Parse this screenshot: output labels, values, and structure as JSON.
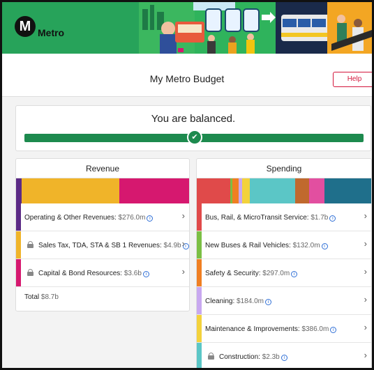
{
  "header": {
    "logo_letter": "M",
    "brand": "Metro"
  },
  "page": {
    "title": "My Metro Budget",
    "help_label": "Help"
  },
  "balance": {
    "message": "You are balanced.",
    "check_icon": "checkmark-icon"
  },
  "revenue": {
    "heading": "Revenue",
    "segments": [
      {
        "color": "#5b2a86",
        "share": 0.032
      },
      {
        "color": "#f0b429",
        "share": 0.563
      },
      {
        "color": "#d6186f",
        "share": 0.405
      }
    ],
    "rows": [
      {
        "label": "Operating & Other Revenues:",
        "amount": "$276.0m",
        "color": "#5b2a86",
        "locked": false
      },
      {
        "label": "Sales Tax, TDA, STA & SB 1 Revenues:",
        "amount": "$4.9b",
        "color": "#f0b429",
        "locked": true
      },
      {
        "label": "Capital & Bond Resources:",
        "amount": "$3.6b",
        "color": "#d6186f",
        "locked": true
      }
    ],
    "total_label": "Total",
    "total_amount": "$8.7b"
  },
  "spending": {
    "heading": "Spending",
    "segments": [
      {
        "color": "#e04a4a",
        "share": 0.19
      },
      {
        "color": "#7bbf44",
        "share": 0.014
      },
      {
        "color": "#f07f22",
        "share": 0.034
      },
      {
        "color": "#c8a8f0",
        "share": 0.021
      },
      {
        "color": "#f3d23c",
        "share": 0.044
      },
      {
        "color": "#5bc6c6",
        "share": 0.26
      },
      {
        "color": "#c0692e",
        "share": 0.08
      },
      {
        "color": "#e24fa0",
        "share": 0.09
      },
      {
        "color": "#1f6f8b",
        "share": 0.267
      }
    ],
    "rows": [
      {
        "label": "Bus, Rail, & MicroTransit Service:",
        "amount": "$1.7b",
        "color": "#e04a4a",
        "locked": false
      },
      {
        "label": "New Buses & Rail Vehicles:",
        "amount": "$132.0m",
        "color": "#7bbf44",
        "locked": false
      },
      {
        "label": "Safety & Security:",
        "amount": "$297.0m",
        "color": "#f07f22",
        "locked": false
      },
      {
        "label": "Cleaning:",
        "amount": "$184.0m",
        "color": "#c8a8f0",
        "locked": false
      },
      {
        "label": "Maintenance & Improvements:",
        "amount": "$386.0m",
        "color": "#f3d23c",
        "locked": false
      },
      {
        "label": "Construction:",
        "amount": "$2.3b",
        "color": "#5bc6c6",
        "locked": true
      }
    ]
  }
}
